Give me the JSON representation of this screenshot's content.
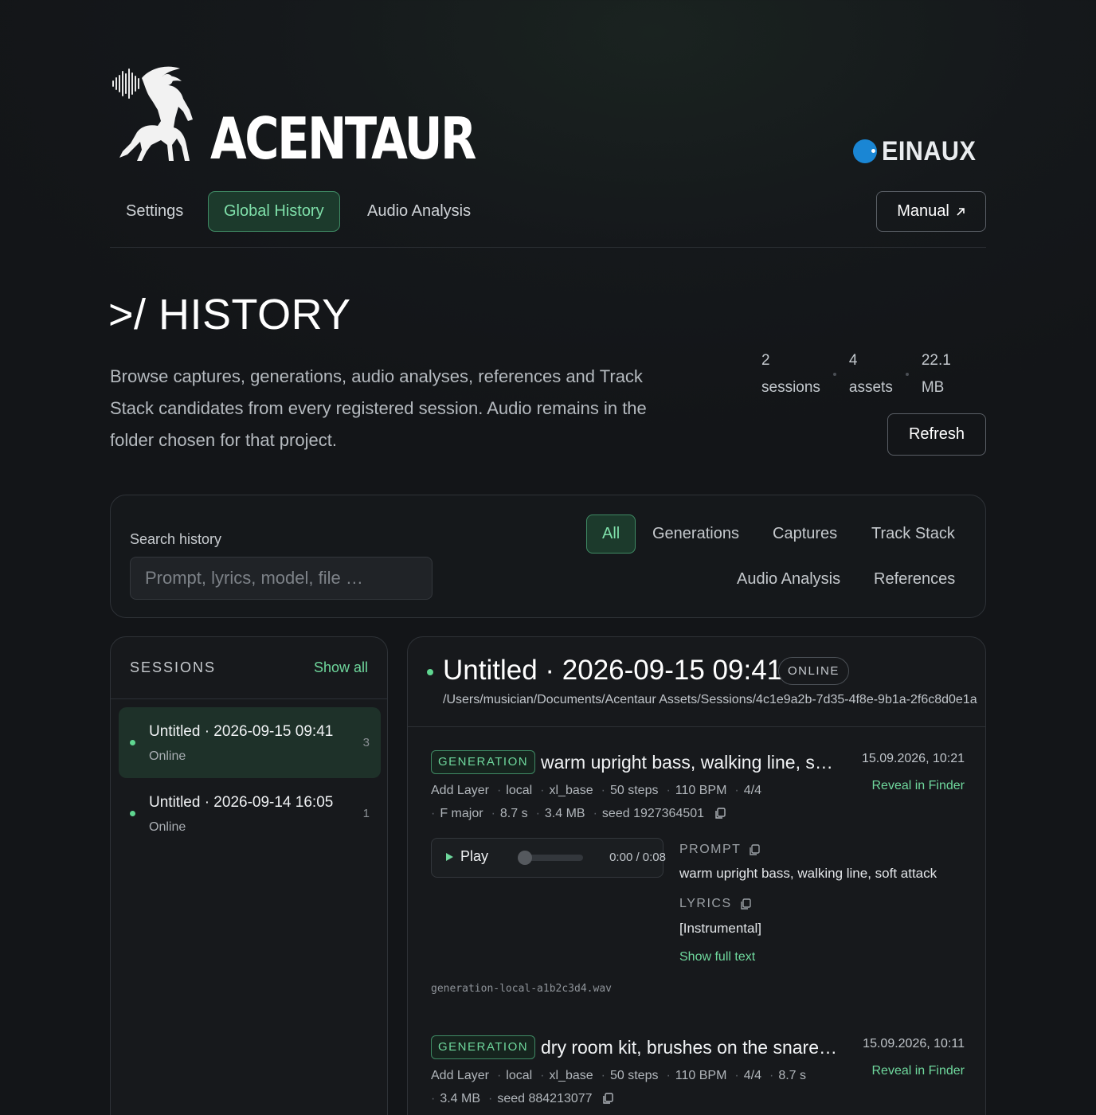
{
  "brand": {
    "name": "ACENTAUR",
    "partner": "EINAUX"
  },
  "nav": {
    "tabs": [
      {
        "label": "Settings"
      },
      {
        "label": "Global History"
      },
      {
        "label": "Audio Analysis"
      }
    ],
    "manual_label": "Manual",
    "manual_icon": "external-link-icon"
  },
  "page": {
    "title": ">/ HISTORY",
    "description": "Browse captures, generations, audio analyses, references and Track Stack candidates from every registered session. Audio remains in the folder chosen for that project.",
    "stats": [
      {
        "value": "2",
        "unit": "sessions"
      },
      {
        "value": "4",
        "unit": "assets"
      },
      {
        "value": "22.1",
        "unit": "MB"
      }
    ],
    "refresh_label": "Refresh"
  },
  "filter": {
    "search_label": "Search history",
    "search_placeholder": "Prompt, lyrics, model, file …",
    "search_value": "",
    "tabs": [
      {
        "label": "All"
      },
      {
        "label": "Generations"
      },
      {
        "label": "Captures"
      },
      {
        "label": "Track Stack"
      },
      {
        "label": "Audio Analysis"
      },
      {
        "label": "References"
      }
    ]
  },
  "sessions": {
    "title": "SESSIONS",
    "show_all": "Show all",
    "items": [
      {
        "name": "Untitled · 2026-09-15 09:41",
        "status": "Online",
        "count": "3"
      },
      {
        "name": "Untitled · 2026-09-14 16:05",
        "status": "Online",
        "count": "1"
      }
    ]
  },
  "detail": {
    "title": "Untitled · 2026-09-15 09:41",
    "badge": "ONLINE",
    "path": "/Users/musician/Documents/Acentaur Assets/Sessions/4c1e9a2b-7d35-4f8e-9b1a-2f6c8d0e1a",
    "entries": [
      {
        "type": "GENERATION",
        "title": "warm upright bass, walking line, soft attack",
        "date": "15.09.2026, 10:21",
        "reveal": "Reveal in Finder",
        "meta_line1": [
          "Add Layer",
          "local",
          "xl_base",
          "50 steps",
          "110 BPM",
          "4/4"
        ],
        "meta_line2": [
          "F major",
          "8.7 s",
          "3.4 MB"
        ],
        "seed": "seed 1927364501",
        "play_label": "Play",
        "time": "0:00 / 0:08",
        "progress": 0,
        "prompt_label": "PROMPT",
        "prompt": "warm upright bass, walking line, soft attack",
        "lyrics_label": "LYRICS",
        "lyrics": "[Instrumental]",
        "show_full": "Show full text",
        "filename": "generation-local-a1b2c3d4.wav"
      },
      {
        "type": "GENERATION",
        "title": "dry room kit, brushes on the snare, light swing",
        "date": "15.09.2026, 10:11",
        "reveal": "Reveal in Finder",
        "meta_line1": [
          "Add Layer",
          "local",
          "xl_base",
          "50 steps",
          "110 BPM",
          "4/4",
          "8.7 s"
        ],
        "meta_line2": [
          "3.4 MB"
        ],
        "seed": "seed 884213077"
      }
    ]
  },
  "colors": {
    "accent": "#6fd89d",
    "accent_bg": "#1c3a2c",
    "background": "#131518",
    "partner_blue": "#1a86d4"
  }
}
